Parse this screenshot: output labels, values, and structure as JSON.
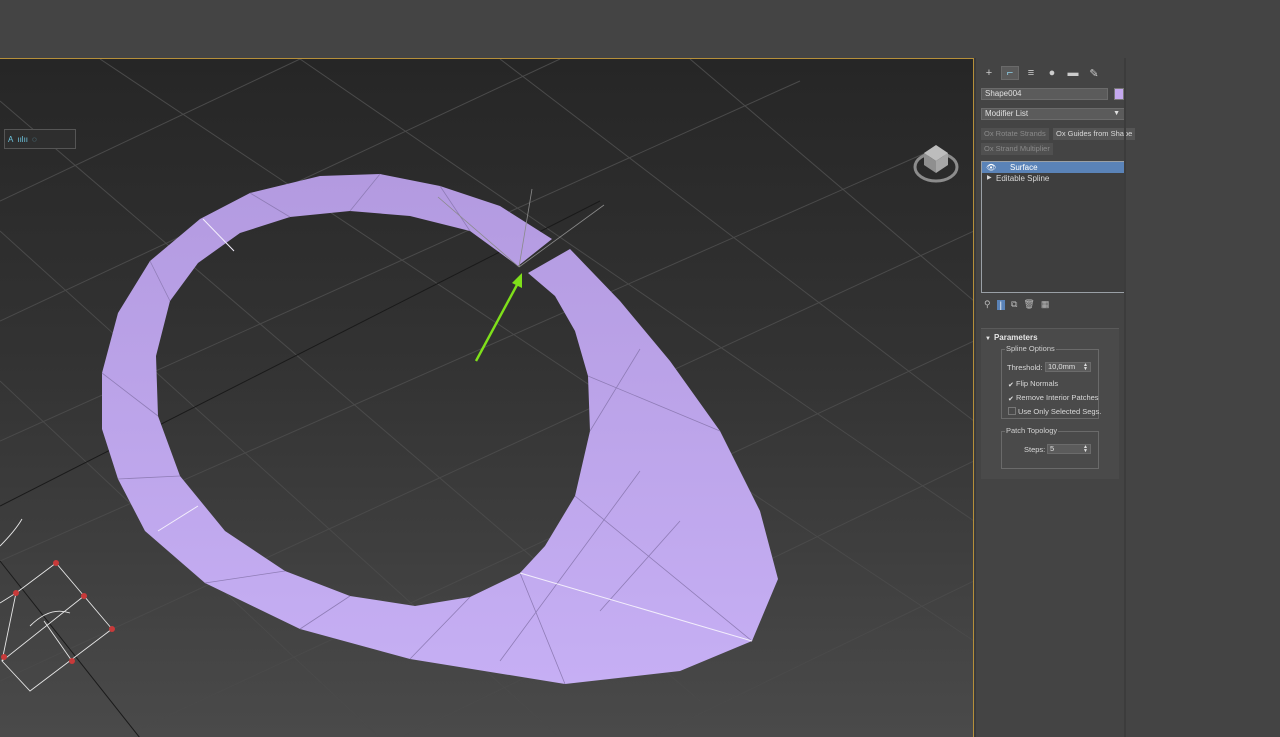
{
  "viewport": {
    "toolbar_labels": [
      "A",
      "ıılıı",
      "◌"
    ]
  },
  "command_panel": {
    "tabs": [
      {
        "icon": "plus-icon",
        "glyph": "+"
      },
      {
        "icon": "modify-icon",
        "glyph": "⌐"
      },
      {
        "icon": "hierarchy-icon",
        "glyph": "≡"
      },
      {
        "icon": "motion-icon",
        "glyph": "●"
      },
      {
        "icon": "display-icon",
        "glyph": "▬"
      },
      {
        "icon": "utilities-icon",
        "glyph": "✎"
      }
    ],
    "object_name": "Shape004",
    "object_color": "#c4a8ee",
    "modifier_list": "Modifier List",
    "buttons": {
      "ox_rotate_strands": "Ox Rotate Strands",
      "ox_guides_from_shape": "Ox Guides from Shape",
      "ox_strand_multiplier": "Ox Strand Multiplier"
    },
    "stack": {
      "items": [
        "Surface",
        "Editable Spline"
      ]
    },
    "parameters": {
      "title": "Parameters",
      "spline_options": {
        "title": "Spline Options",
        "threshold_label": "Threshold:",
        "threshold_value": "10,0mm",
        "flip_normals": "Flip Normals",
        "flip_normals_checked": true,
        "remove_interior_patches": "Remove Interior Patches",
        "remove_interior_patches_checked": true,
        "use_only_selected_segs": "Use Only Selected Segs.",
        "use_only_selected_segs_checked": false
      },
      "patch_topology": {
        "title": "Patch Topology",
        "steps_label": "Steps:",
        "steps_value": "5"
      }
    }
  },
  "colors": {
    "surface_fill": "#c4a8ee",
    "viewport_border": "#b58f3a",
    "arrow": "#7fe01a",
    "selection": "#5a83b8"
  }
}
